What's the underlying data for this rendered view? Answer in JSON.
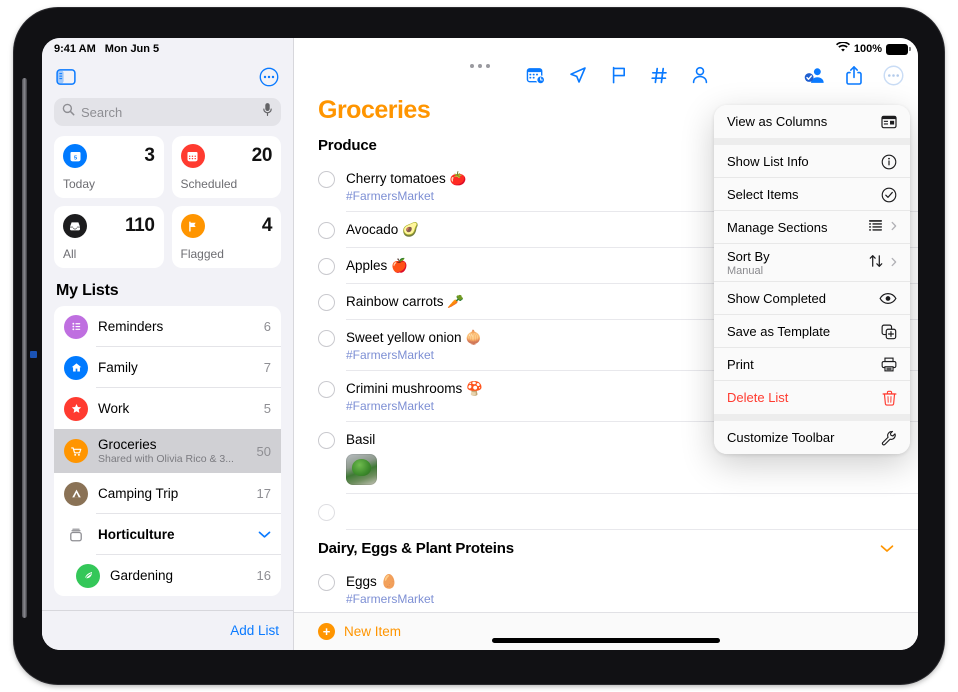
{
  "status_bar": {
    "time": "9:41 AM",
    "date": "Mon Jun 5",
    "wifi_icon": "wifi-icon",
    "battery_percent": "100%",
    "battery_icon": "battery-full-icon"
  },
  "sidebar": {
    "toggle_sidebar_icon": "sidebar-toggle-icon",
    "more_icon": "ellipsis-circle-icon",
    "search": {
      "placeholder": "Search",
      "search_icon": "search-icon",
      "mic_icon": "microphone-icon"
    },
    "smart_lists": [
      {
        "name": "today",
        "label": "Today",
        "count": "3",
        "icon": "calendar-today-icon",
        "color": "#007aff"
      },
      {
        "name": "scheduled",
        "label": "Scheduled",
        "count": "20",
        "icon": "calendar-scheduled-icon",
        "color": "#ff3b30"
      },
      {
        "name": "all",
        "label": "All",
        "count": "110",
        "icon": "tray-all-icon",
        "color": "#1c1c1e"
      },
      {
        "name": "flagged",
        "label": "Flagged",
        "count": "4",
        "icon": "flag-icon",
        "color": "#ff9500"
      }
    ],
    "my_lists_header": "My Lists",
    "lists": [
      {
        "name": "reminders",
        "label": "Reminders",
        "count": "6",
        "icon": "bullet-list-icon",
        "color": "#bf6fe0",
        "subtitle": "",
        "group": false,
        "indent": false,
        "bold": false
      },
      {
        "name": "family",
        "label": "Family",
        "count": "7",
        "icon": "house-icon",
        "color": "#007aff",
        "subtitle": "",
        "group": false,
        "indent": false,
        "bold": false
      },
      {
        "name": "work",
        "label": "Work",
        "count": "5",
        "icon": "star-icon",
        "color": "#ff3b30",
        "subtitle": "",
        "group": false,
        "indent": false,
        "bold": false
      },
      {
        "name": "groceries",
        "label": "Groceries",
        "count": "50",
        "icon": "cart-icon",
        "color": "#ff9500",
        "subtitle": "Shared with Olivia Rico & 3...",
        "group": false,
        "indent": false,
        "bold": false
      },
      {
        "name": "camping-trip",
        "label": "Camping Trip",
        "count": "17",
        "icon": "tent-icon",
        "color": "#8a7256",
        "subtitle": "",
        "group": false,
        "indent": false,
        "bold": false
      },
      {
        "name": "horticulture",
        "label": "Horticulture",
        "count": "",
        "icon": "folder-group-icon",
        "color": "#8e8e93",
        "subtitle": "",
        "group": true,
        "indent": false,
        "bold": true
      },
      {
        "name": "gardening",
        "label": "Gardening",
        "count": "16",
        "icon": "leaf-icon",
        "color": "#34c759",
        "subtitle": "",
        "group": false,
        "indent": true,
        "bold": false
      }
    ],
    "selected_list": "groceries",
    "group_chevron_icon": "chevron-down-icon",
    "add_list_label": "Add List"
  },
  "main": {
    "title": "Groceries",
    "title_color": "#ff9500",
    "toolbar_center_icons": [
      {
        "name": "add-date-icon",
        "glyph": "calendar-clock-icon"
      },
      {
        "name": "add-location-icon",
        "glyph": "location-arrow-icon"
      },
      {
        "name": "add-flag-icon",
        "glyph": "flag-outline-icon"
      },
      {
        "name": "add-tag-icon",
        "glyph": "hashtag-icon"
      },
      {
        "name": "add-person-icon",
        "glyph": "person-icon"
      }
    ],
    "toolbar_right_icons": [
      {
        "name": "collaborate-icon",
        "glyph": "person-badge-icon"
      },
      {
        "name": "share-icon",
        "glyph": "share-square-up-icon"
      },
      {
        "name": "more-icon",
        "glyph": "ellipsis-circle-icon"
      }
    ],
    "sections": [
      {
        "name": "produce",
        "title": "Produce",
        "collapsible": false,
        "items": [
          {
            "title": "Cherry tomatoes 🍅",
            "tag": "#FarmersMarket",
            "photo": false
          },
          {
            "title": "Avocado 🥑",
            "tag": "",
            "photo": false
          },
          {
            "title": "Apples 🍎",
            "tag": "",
            "photo": false
          },
          {
            "title": "Rainbow carrots 🥕",
            "tag": "",
            "photo": false
          },
          {
            "title": "Sweet yellow onion 🧅",
            "tag": "#FarmersMarket",
            "photo": false
          },
          {
            "title": "Crimini mushrooms 🍄",
            "tag": "#FarmersMarket",
            "photo": false
          },
          {
            "title": "Basil",
            "tag": "",
            "photo": true
          },
          {
            "title": "",
            "tag": "",
            "photo": false
          }
        ]
      },
      {
        "name": "dairy-eggs-plant-proteins",
        "title": "Dairy, Eggs & Plant Proteins",
        "collapsible": true,
        "items": [
          {
            "title": "Eggs 🥚",
            "tag": "#FarmersMarket",
            "photo": false
          }
        ]
      }
    ],
    "new_item_label": "New Item",
    "new_item_icon": "plus-circle-icon"
  },
  "context_menu": {
    "groups": [
      {
        "items": [
          {
            "name": "view-as-columns",
            "label": "View as Columns",
            "sub": "",
            "icon": "columns-icon",
            "chevron": false,
            "destructive": false
          }
        ]
      },
      {
        "items": [
          {
            "name": "show-list-info",
            "label": "Show List Info",
            "sub": "",
            "icon": "info-circle-icon",
            "chevron": false,
            "destructive": false
          },
          {
            "name": "select-items",
            "label": "Select Items",
            "sub": "",
            "icon": "checkmark-circle-icon",
            "chevron": false,
            "destructive": false
          },
          {
            "name": "manage-sections",
            "label": "Manage Sections",
            "sub": "",
            "icon": "sections-list-icon",
            "chevron": true,
            "destructive": false
          },
          {
            "name": "sort-by",
            "label": "Sort By",
            "sub": "Manual",
            "icon": "sort-arrows-icon",
            "chevron": true,
            "destructive": false
          },
          {
            "name": "show-completed",
            "label": "Show Completed",
            "sub": "",
            "icon": "eye-icon",
            "chevron": false,
            "destructive": false
          },
          {
            "name": "save-as-template",
            "label": "Save as Template",
            "sub": "",
            "icon": "duplicate-plus-icon",
            "chevron": false,
            "destructive": false
          },
          {
            "name": "print",
            "label": "Print",
            "sub": "",
            "icon": "printer-icon",
            "chevron": false,
            "destructive": false
          },
          {
            "name": "delete-list",
            "label": "Delete List",
            "sub": "",
            "icon": "trash-icon",
            "chevron": false,
            "destructive": true
          }
        ]
      },
      {
        "items": [
          {
            "name": "customize-toolbar",
            "label": "Customize Toolbar",
            "sub": "",
            "icon": "wrench-icon",
            "chevron": false,
            "destructive": false
          }
        ]
      }
    ]
  }
}
